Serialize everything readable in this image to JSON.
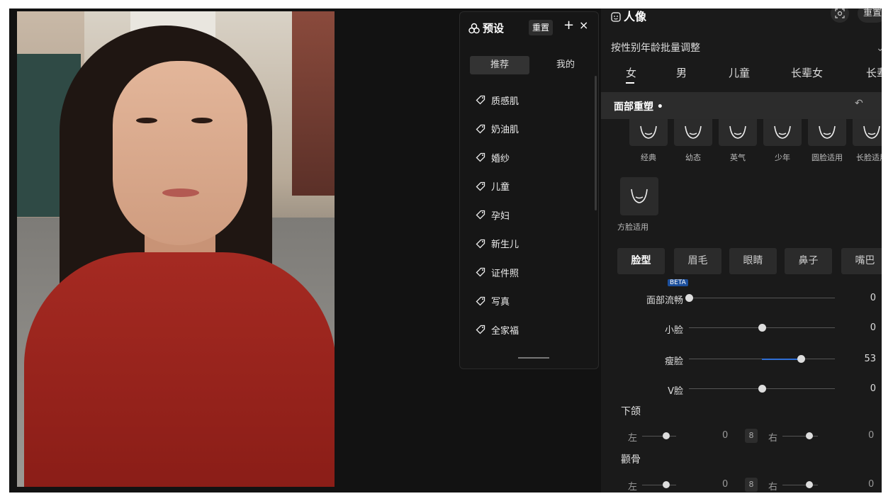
{
  "presets": {
    "title": "预设",
    "reset_label": "重置",
    "add_label": "+",
    "close_label": "×",
    "tabs": [
      "推荐",
      "我的"
    ],
    "items": [
      "质感肌",
      "奶油肌",
      "婚纱",
      "儿童",
      "孕妇",
      "新生儿",
      "证件照",
      "写真",
      "全家福"
    ]
  },
  "portrait": {
    "title": "人像",
    "reset_label": "重置",
    "batch_label": "按性别年龄批量调整",
    "gender_tabs": [
      "女",
      "男",
      "儿童",
      "长辈女",
      "长辈"
    ],
    "face_section": "面部重塑 •",
    "shapes": [
      "经典",
      "幼态",
      "英气",
      "少年",
      "圆脸适用",
      "长脸适用"
    ],
    "square_shape": "方脸适用",
    "categories": [
      "脸型",
      "眉毛",
      "眼睛",
      "鼻子",
      "嘴巴"
    ],
    "beta_label": "BETA",
    "sliders": [
      {
        "name": "面部流畅",
        "value": "0",
        "level": 0.0
      },
      {
        "name": "小脸",
        "value": "0",
        "level": 0.5
      },
      {
        "name": "瘦脸",
        "value": "53",
        "level": 0.765
      },
      {
        "name": "V脸",
        "value": "0",
        "level": 0.5
      }
    ],
    "jaw_label": "下颌",
    "cheek_label": "颧骨",
    "pair_left": "左",
    "pair_right": "右",
    "jaw_values": [
      "0",
      "0"
    ],
    "cheek_values": [
      "0",
      "0"
    ]
  },
  "colors": {
    "accent": "#2f6fd6",
    "panel": "#1a1a1a",
    "bg": "#121212"
  }
}
